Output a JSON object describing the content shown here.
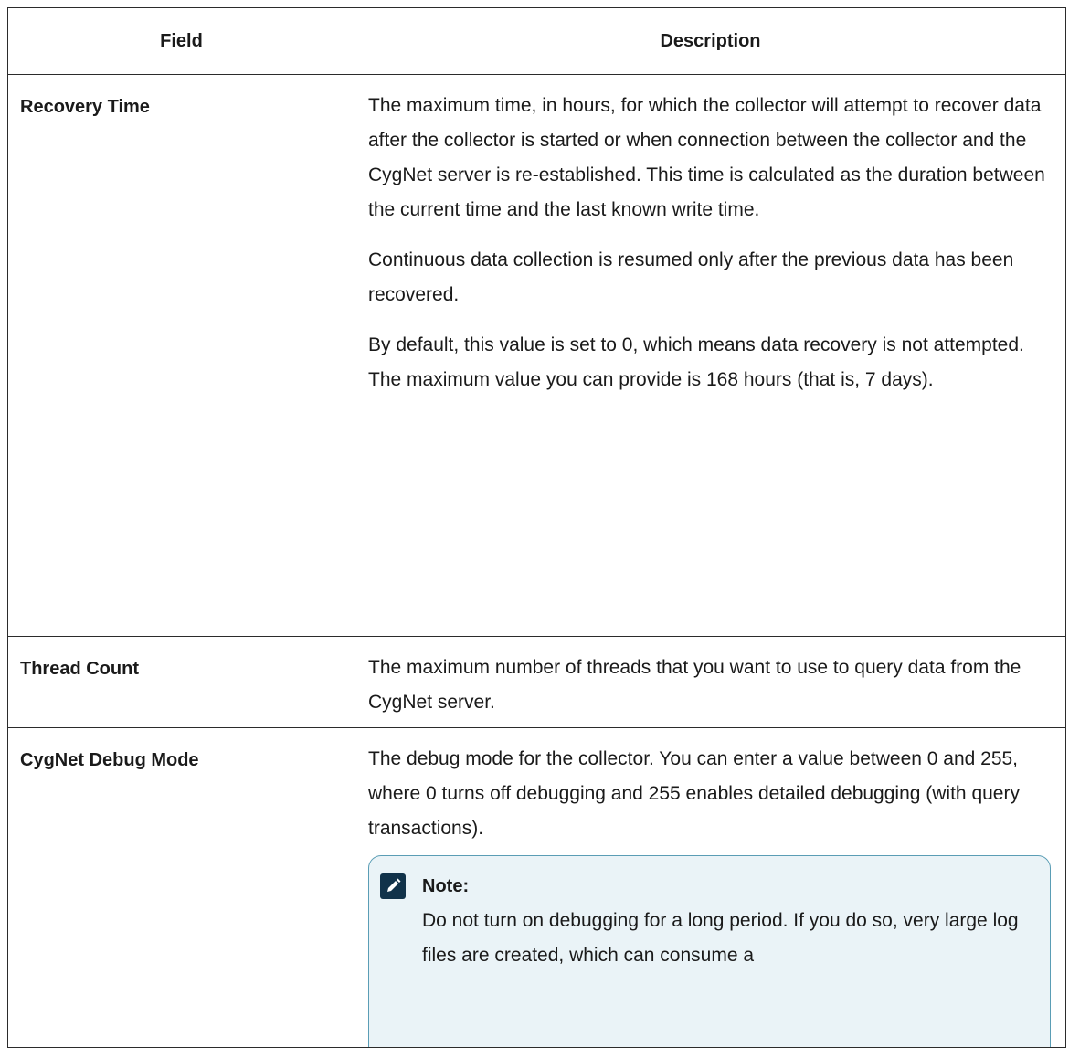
{
  "table": {
    "headers": {
      "field": "Field",
      "description": "Description"
    },
    "rows": [
      {
        "field": "Recovery Time",
        "paragraphs": [
          "The maximum time, in hours, for which the collector will attempt to recover data after the collector is started or when connection between the collector and the CygNet server is re-established. This time is calculated as the duration between the current time and the last known write time.",
          "Continuous data collection is resumed only after the previous data has been recovered.",
          "By default, this value is set to 0, which means data recovery is not attempted. The maximum value you can provide is 168 hours (that is, 7 days)."
        ]
      },
      {
        "field": "Thread Count",
        "paragraphs": [
          "The maximum number of threads that you want to use to query data from the CygNet server."
        ]
      },
      {
        "field": "CygNet Debug Mode",
        "paragraphs": [
          "The debug mode for the collector. You can enter a value between 0 and 255, where 0 turns off debugging and 255 enables detailed debugging (with query transactions)."
        ],
        "note": {
          "icon": "pencil-icon",
          "title": "Note:",
          "text": "Do not turn on debugging for a long period. If you do so, very large log files are created, which can consume a"
        }
      }
    ]
  },
  "colors": {
    "border": "#2b2b2b",
    "note_border": "#5a9db5",
    "note_bg": "#eaf3f7",
    "note_icon_bg": "#11324a"
  }
}
